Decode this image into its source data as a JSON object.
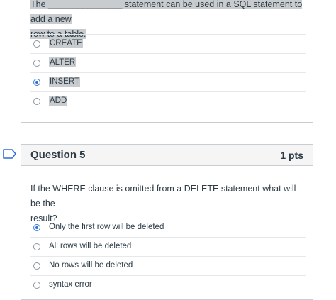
{
  "question4": {
    "text_line1": "The _______________ statement can be used in a SQL statement to add a new",
    "text_line2": "row to a table.",
    "answers": [
      {
        "label": "CREATE",
        "selected": false
      },
      {
        "label": "ALTER",
        "selected": false
      },
      {
        "label": "INSERT",
        "selected": true
      },
      {
        "label": "ADD",
        "selected": false
      }
    ]
  },
  "question5": {
    "title": "Question 5",
    "points": "1 pts",
    "text_line1": "If the WHERE clause is omitted from a DELETE statement what will be the",
    "text_line2": "result?",
    "answers": [
      {
        "label": "Only the first row will be deleted",
        "selected": true
      },
      {
        "label": "All rows will be deleted",
        "selected": false
      },
      {
        "label": "No rows will be deleted",
        "selected": false
      },
      {
        "label": "syntax error",
        "selected": false
      }
    ]
  },
  "colors": {
    "accent": "#2f6fd0",
    "flag": "#2f6fd0",
    "header_bg": "#f5f5f5",
    "border": "#c7cdd1"
  },
  "icons": {
    "flag": "flag-question-icon"
  }
}
